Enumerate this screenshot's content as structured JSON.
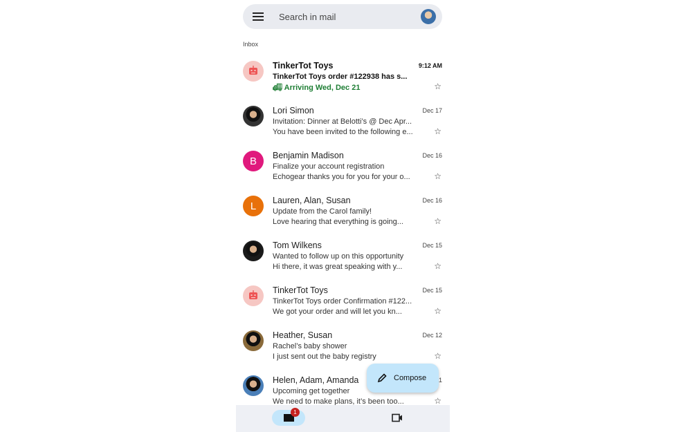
{
  "search": {
    "placeholder": "Search in mail"
  },
  "section": "Inbox",
  "emails": [
    {
      "sender": "TinkerTot Toys",
      "subject": "TinkerTot Toys order #122938 has s...",
      "snippet": "Arriving Wed, Dec 21",
      "date": "9:12 AM",
      "unread": true,
      "avatar": "robot",
      "color": "#f6c7c3"
    },
    {
      "sender": "Lori Simon",
      "subject": "Invitation: Dinner at Belotti’s @ Dec Apr...",
      "snippet": "You have been invited to the following e...",
      "date": "Dec 17",
      "avatar": "photo",
      "color": "#333333"
    },
    {
      "sender": "Benjamin Madison",
      "subject": "Finalize your account registration",
      "snippet": "Echogear thanks you for you for your o...",
      "date": "Dec 16",
      "avatar": "B",
      "color": "#e0197d"
    },
    {
      "sender": "Lauren, Alan, Susan",
      "subject": "Update from the Carol family!",
      "snippet": "Love hearing that everything is going...",
      "date": "Dec 16",
      "avatar": "L",
      "color": "#e8710a"
    },
    {
      "sender": "Tom Wilkens",
      "subject": "Wanted to follow up on this opportunity",
      "snippet": "Hi there, it was great speaking with y...",
      "date": "Dec 15",
      "avatar": "photo",
      "color": "#1a1a1a"
    },
    {
      "sender": "TinkerTot Toys",
      "subject": "TinkerTot Toys order Confirmation #122...",
      "snippet": "We got your order and will let you kn...",
      "date": "Dec 15",
      "avatar": "robot",
      "color": "#f6c7c3"
    },
    {
      "sender": "Heather, Susan",
      "subject": "Rachel’s baby shower",
      "snippet": "I just sent out the baby registry",
      "date": "Dec 12",
      "avatar": "photo",
      "color": "#8a6a3a"
    },
    {
      "sender": "Helen, Adam, Amanda",
      "subject": "Upcoming get together",
      "snippet": "We need to make plans, it’s been too...",
      "date": "Dec 11",
      "avatar": "photo",
      "color": "#4a7fb8"
    }
  ],
  "compose": {
    "label": "Compose"
  },
  "nav": {
    "mail_badge": "1"
  }
}
